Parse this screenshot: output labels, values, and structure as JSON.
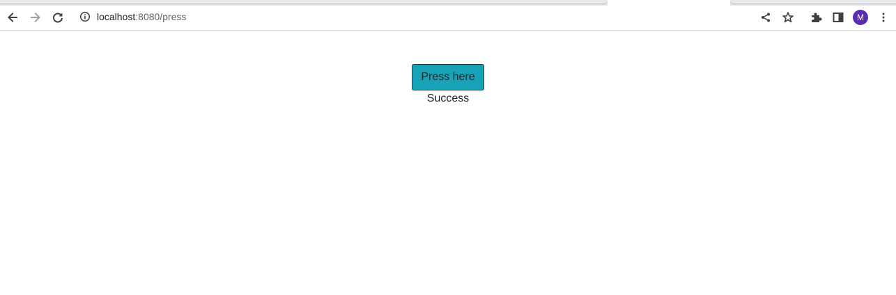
{
  "browser": {
    "url_host": "localhost",
    "url_rest": ":8080/press",
    "profile_initial": "M",
    "accent_color": "#5b2bb0"
  },
  "toolbar": {
    "icons": [
      "back-arrow-icon",
      "forward-arrow-icon",
      "reload-icon",
      "info-icon",
      "share-icon",
      "star-icon",
      "extensions-puzzle-icon",
      "side-panel-icon",
      "kebab-menu-icon"
    ]
  },
  "page": {
    "button_label": "Press here",
    "button_color": "#17a2b8",
    "status_text": "Success"
  }
}
